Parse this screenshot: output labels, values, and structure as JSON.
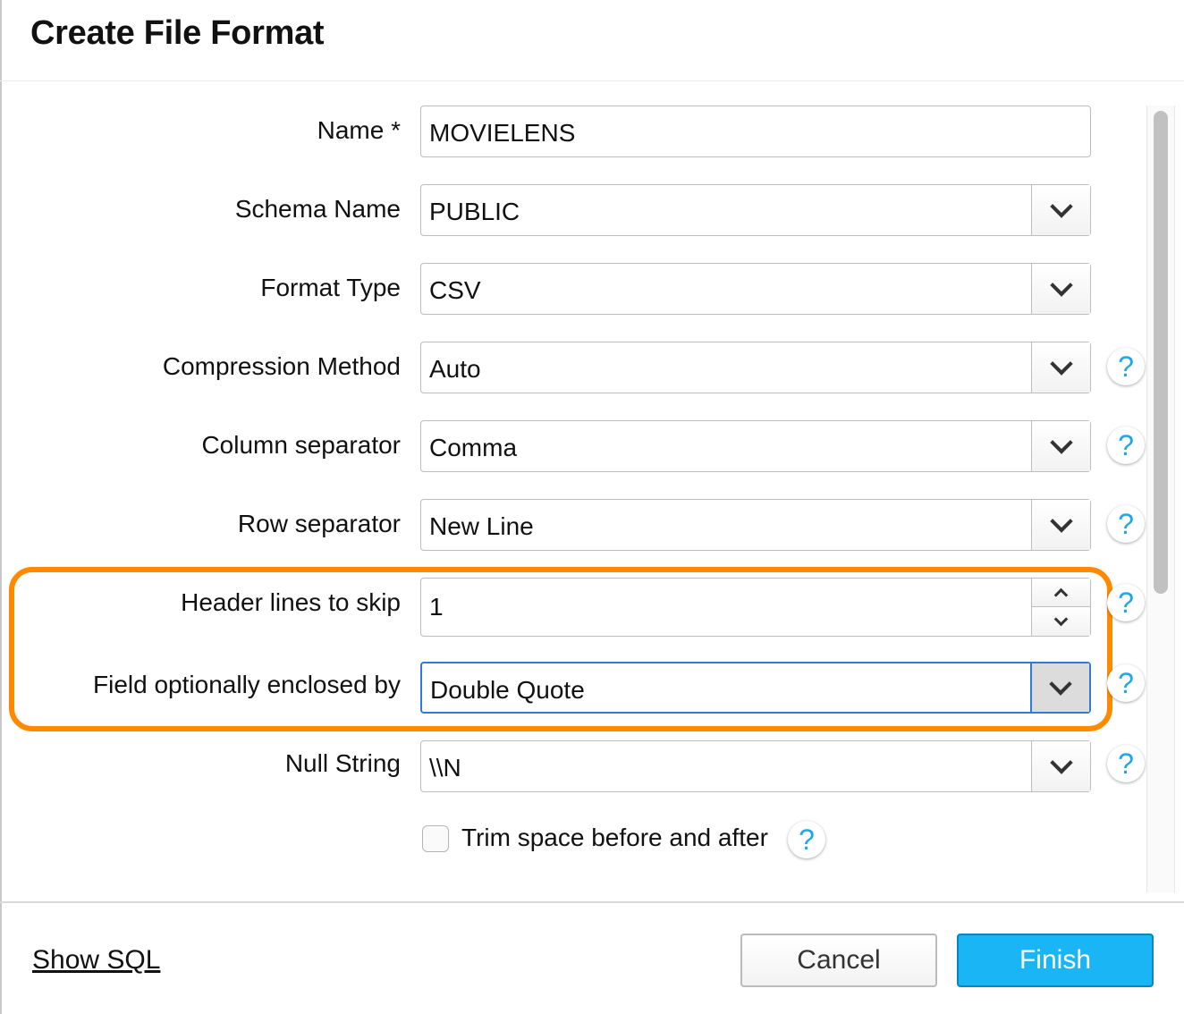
{
  "dialog": {
    "title": "Create File Format"
  },
  "form": {
    "name": {
      "label": "Name *",
      "value": "MOVIELENS"
    },
    "schema_name": {
      "label": "Schema Name",
      "value": "PUBLIC"
    },
    "format_type": {
      "label": "Format Type",
      "value": "CSV"
    },
    "compression_method": {
      "label": "Compression Method",
      "value": "Auto",
      "help": "?"
    },
    "column_separator": {
      "label": "Column separator",
      "value": "Comma",
      "help": "?"
    },
    "row_separator": {
      "label": "Row separator",
      "value": "New Line",
      "help": "?"
    },
    "header_lines": {
      "label": "Header lines to skip",
      "value": "1",
      "help": "?"
    },
    "field_enclosed": {
      "label": "Field optionally enclosed by",
      "value": "Double Quote",
      "help": "?"
    },
    "null_string": {
      "label": "Null String",
      "value": "\\\\N",
      "help": "?"
    },
    "trim_space": {
      "label": "Trim space before and after",
      "checked": false,
      "help": "?"
    }
  },
  "footer": {
    "show_sql": "Show SQL",
    "cancel": "Cancel",
    "finish": "Finish"
  },
  "colors": {
    "highlight": "#ff8a00",
    "focus": "#2f7bd6",
    "primary": "#19b5f5",
    "help_icon": "#1ea8e6"
  }
}
